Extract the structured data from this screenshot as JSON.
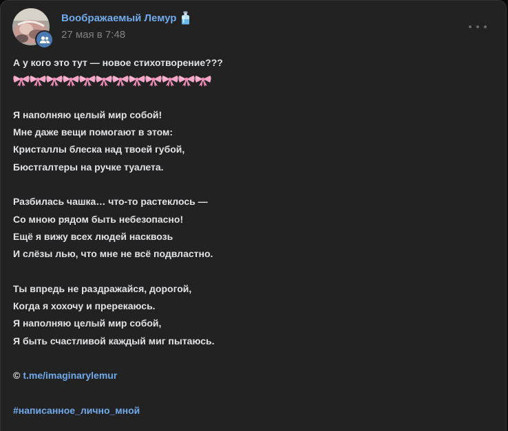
{
  "author": {
    "name": "Воображаемый Лемур",
    "date": "27 мая в 7:48",
    "name_emoji": "bottle-emoji",
    "avatar_badge_icon": "group-icon"
  },
  "menu": {
    "more_icon": "ellipsis-icon"
  },
  "post": {
    "intro": "А у кого это тут — новое стихотворение???",
    "bow_emoji_count": 12,
    "bow_emoji": "ribbon-emoji",
    "stanzas": [
      {
        "lines": [
          "Я наполняю целый мир собой!",
          "Мне даже вещи помогают в этом:",
          "Кристаллы блеска над твоей губой,",
          "Бюстгалтеры на ручке туалета."
        ]
      },
      {
        "lines": [
          "Разбилась чашка… что-то растеклось —",
          "Со мною рядом быть небезопасно!",
          "Ещё я вижу всех людей насквозь",
          "И слёзы лью, что мне не всё подвластно."
        ]
      },
      {
        "lines": [
          "Ты впредь не раздражайся, дорогой,",
          "Когда я хохочу и пререкаюсь.",
          "Я наполняю целый мир собой,",
          "Я быть счастливой каждый миг пытаюсь."
        ]
      }
    ],
    "copyright_symbol": "©",
    "link": "t.me/imaginarylemur",
    "hashtag": "#написанное_лично_мной"
  },
  "colors": {
    "background": "#0a0a0a",
    "card": "#222222",
    "text": "#e1e3e6",
    "accent": "#71aaeb",
    "muted": "#828282",
    "bow": "#f3a6c8"
  }
}
